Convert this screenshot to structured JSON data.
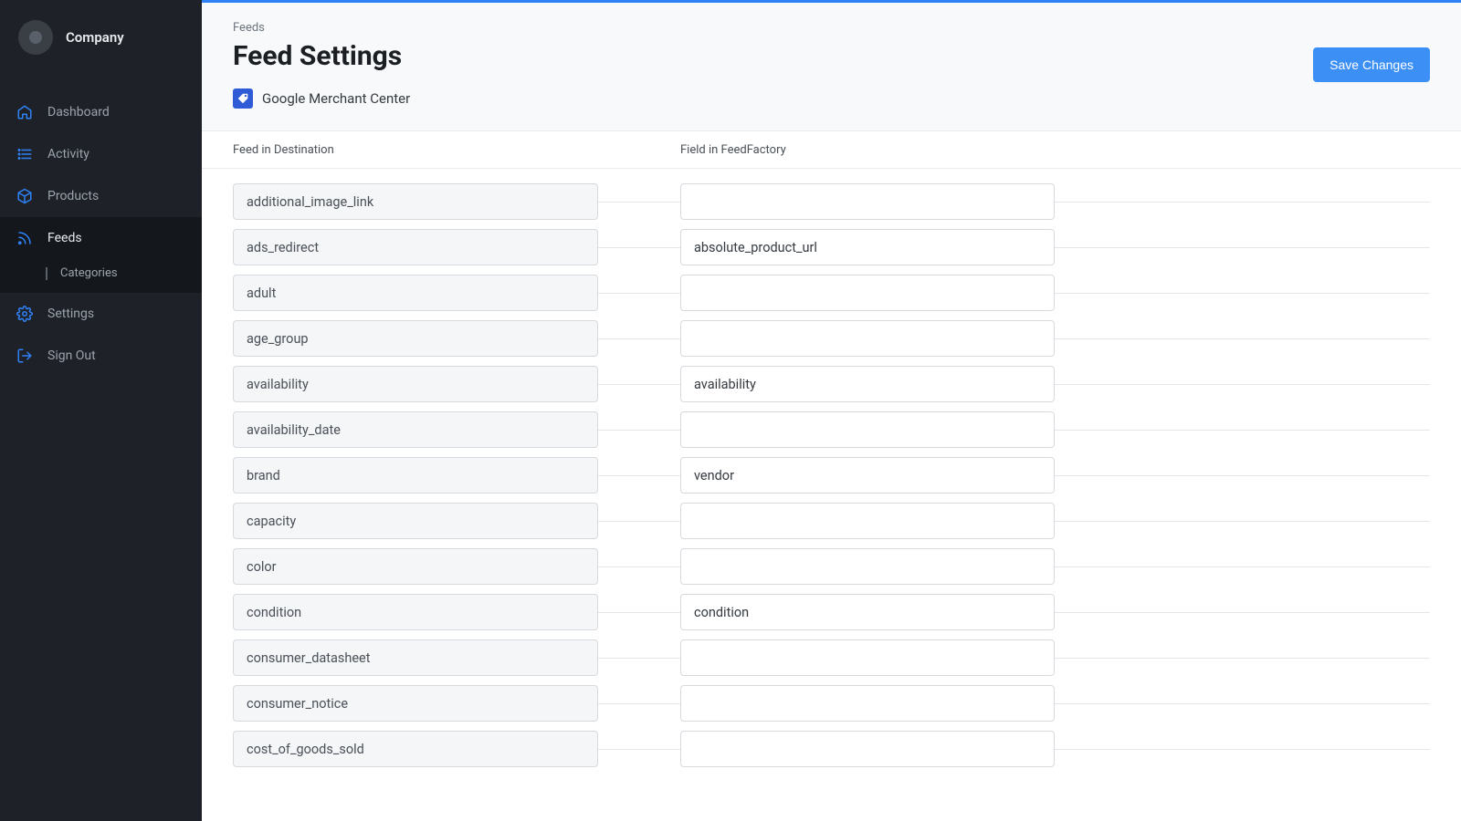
{
  "brand": {
    "name": "Company"
  },
  "sidebar": {
    "items": [
      {
        "key": "dashboard",
        "label": "Dashboard"
      },
      {
        "key": "activity",
        "label": "Activity"
      },
      {
        "key": "products",
        "label": "Products"
      },
      {
        "key": "feeds",
        "label": "Feeds"
      },
      {
        "key": "settings",
        "label": "Settings"
      },
      {
        "key": "signout",
        "label": "Sign Out"
      }
    ],
    "sub": {
      "feeds_categories": "Categories"
    }
  },
  "header": {
    "breadcrumb": "Feeds",
    "title": "Feed Settings",
    "feed_type_label": "Google Merchant Center",
    "save_label": "Save Changes"
  },
  "columns": {
    "left": "Feed in Destination",
    "right": "Field in FeedFactory"
  },
  "mappings": [
    {
      "dest": "additional_image_link",
      "src": ""
    },
    {
      "dest": "ads_redirect",
      "src": "absolute_product_url"
    },
    {
      "dest": "adult",
      "src": ""
    },
    {
      "dest": "age_group",
      "src": ""
    },
    {
      "dest": "availability",
      "src": "availability"
    },
    {
      "dest": "availability_date",
      "src": ""
    },
    {
      "dest": "brand",
      "src": "vendor"
    },
    {
      "dest": "capacity",
      "src": ""
    },
    {
      "dest": "color",
      "src": ""
    },
    {
      "dest": "condition",
      "src": "condition"
    },
    {
      "dest": "consumer_datasheet",
      "src": ""
    },
    {
      "dest": "consumer_notice",
      "src": ""
    },
    {
      "dest": "cost_of_goods_sold",
      "src": ""
    }
  ]
}
